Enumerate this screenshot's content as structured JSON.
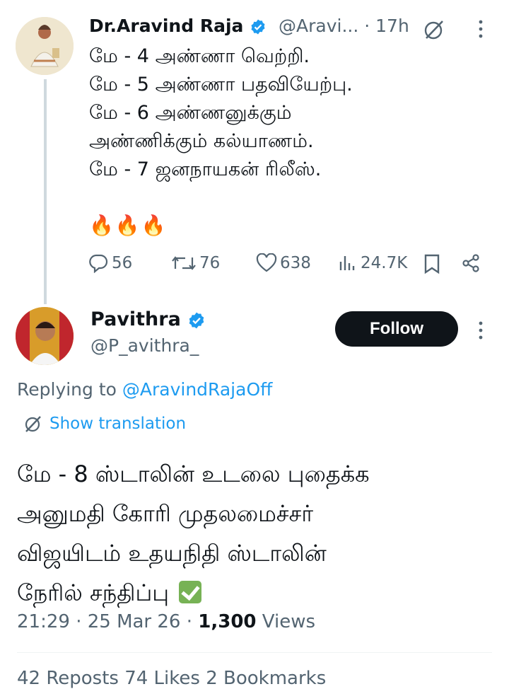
{
  "tweet1": {
    "name": "Dr.Aravind Raja",
    "handle": "@Aravi...",
    "time": "· 17h",
    "lines": [
      "மே - 4 அண்ணா வெற்றி.",
      "மே - 5  அண்ணா பதவியேற்பு.",
      "மே - 6 அண்ணனுக்கும்",
      "அண்ணிக்கும் கல்யாணம்.",
      "மே - 7 ஜனநாயகன் ரிலீஸ்."
    ],
    "emoji": "🔥🔥🔥",
    "replies": "56",
    "retweets": "76",
    "likes": "638",
    "views": "24.7K"
  },
  "tweet2": {
    "name": "Pavithra",
    "handle": "@P_avithra_",
    "follow_label": "Follow",
    "replying_prefix": "Replying to ",
    "replying_to": "@AravindRajaOff",
    "translate_label": "Show translation",
    "lines": [
      "மே - 8 ஸ்டாலின் உடலை புதைக்க",
      "அனுமதி கோரி முதலமைச்சர்",
      "விஜயிடம் உதயநிதி ஸ்டாலின்",
      "நேரில் சந்திப்பு"
    ],
    "time": "21:29 · 25 Mar 26 · ",
    "views_count": "1,300",
    "views_label": " Views",
    "stats_partial": "42 Reposts   74 Likes   2 Bookmarks"
  },
  "colors": {
    "accent": "#1d9bf0",
    "secondary_text": "#536471",
    "primary_text": "#0f1419"
  }
}
